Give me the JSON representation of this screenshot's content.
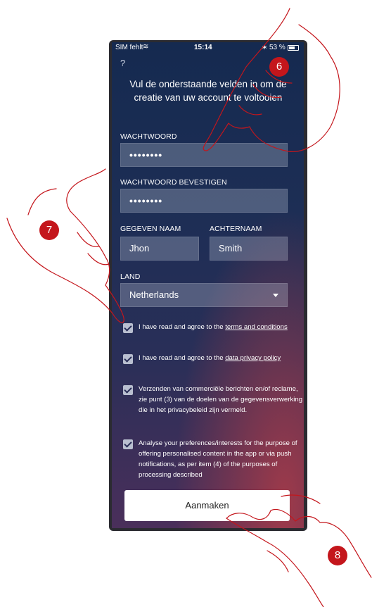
{
  "status_bar": {
    "carrier": "SIM fehlt",
    "time": "15:14",
    "battery": "53 %"
  },
  "header": {
    "help": "?",
    "intro": "Vul de onderstaande velden in om de creatie van uw account te voltooien"
  },
  "form": {
    "password_label": "WACHTWOORD",
    "password_value": "••••••••",
    "confirm_label": "WACHTWOORD BEVESTIGEN",
    "confirm_value": "••••••••",
    "first_name_label": "GEGEVEN NAAM",
    "first_name_value": "Jhon",
    "last_name_label": "ACHTERNAAM",
    "last_name_value": "Smith",
    "country_label": "LAND",
    "country_value": "Netherlands"
  },
  "consents": [
    {
      "text": "I have read and agree to the ",
      "link": "terms and conditions"
    },
    {
      "text": "I have read and agree to the ",
      "link": "data privacy policy"
    },
    {
      "text": "Verzenden van commerciële berichten en/of reclame, zie punt (3) van de doelen van de gegevensverwerking die in het privacybeleid zijn vermeld.",
      "link": ""
    },
    {
      "text": "Analyse your preferences/interests for the purpose of offering personalised content in the app or via push notifications, as per item (4) of the purposes of processing described",
      "link": ""
    }
  ],
  "submit_label": "Aanmaken",
  "step_badges": {
    "six": "6",
    "seven": "7",
    "eight": "8"
  },
  "colors": {
    "badge": "#c4161c",
    "hand_outline": "#c4161c"
  }
}
